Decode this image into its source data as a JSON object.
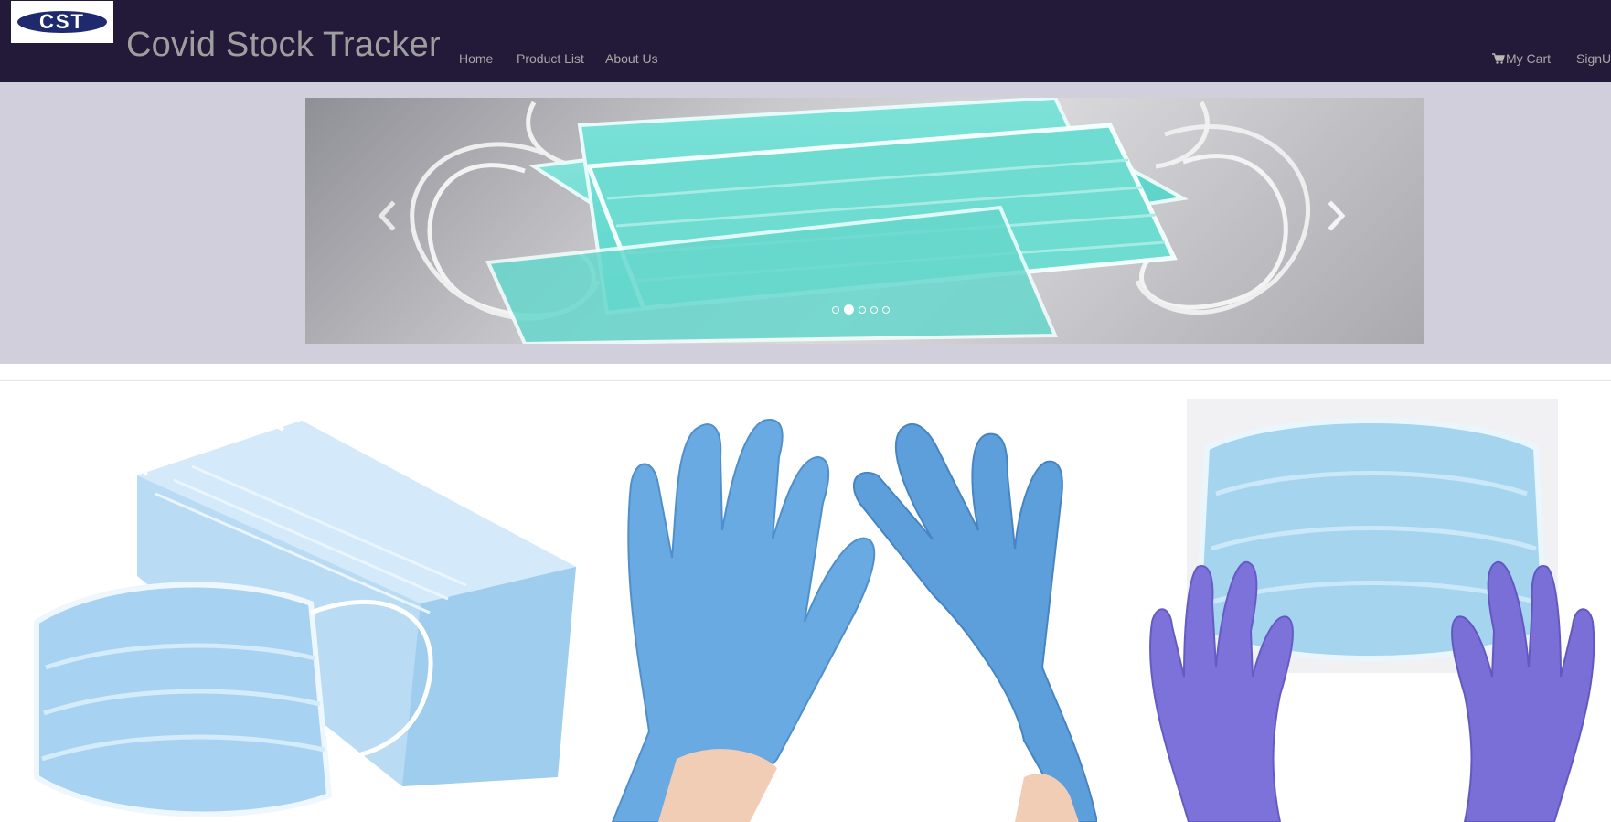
{
  "navbar": {
    "logo_text": "CST",
    "brand": "Covid Stock Tracker",
    "links": {
      "home": "Home",
      "products": "Product List",
      "about": "About Us"
    },
    "cart": "My Cart",
    "signup": "SignUp",
    "background": "#221a38"
  },
  "carousel": {
    "slide_count": 5,
    "active_index": 1,
    "slide_image": "face-masks-pile",
    "prev_icon": "chevron-left-icon",
    "next_icon": "chevron-right-icon"
  },
  "products": [
    {
      "image": "surgical-mask-box"
    },
    {
      "image": "blue-nitrile-gloves"
    },
    {
      "image": "mask-and-purple-gloves"
    }
  ],
  "colors": {
    "jumbotron": "#d2cfdd",
    "nav_text": "#a7a7a7",
    "brand_text": "#9e9e9e",
    "mask_teal": "#66d9d0",
    "mask_blue": "#a9d4f0",
    "glove_blue": "#6aa8e0",
    "glove_purple": "#7a6fd6"
  }
}
